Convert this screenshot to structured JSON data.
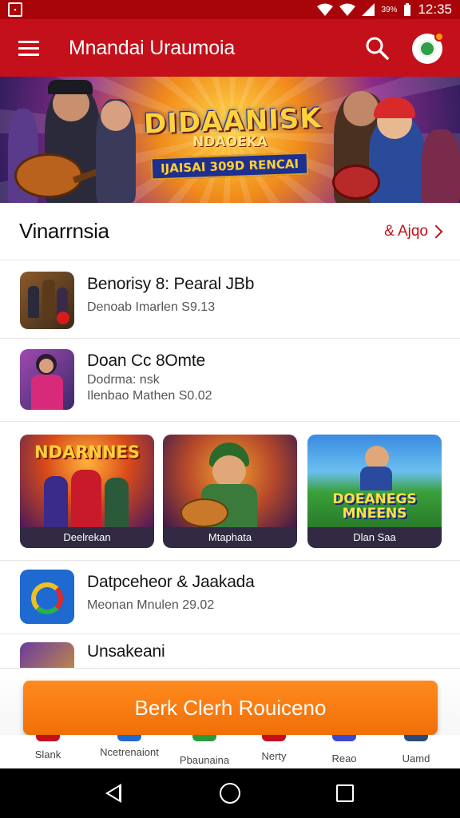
{
  "status_bar": {
    "battery_pct": "39%",
    "time": "12:35"
  },
  "app_bar": {
    "title": "Mnandai Uraumoia"
  },
  "banner": {
    "logo_main": "DIDAANISK",
    "logo_sub": "NDAOEKA",
    "logo_ribbon": "IJAISAI 309D RENCAI"
  },
  "section": {
    "title": "Vinarrnsia",
    "more_label": "& Ajqo"
  },
  "list_items": [
    {
      "title": "Benorisy 8: Pearal JBb",
      "subtitle_1": "Denoab Imarlen S9.13",
      "subtitle_2": ""
    },
    {
      "title": "Doan Cc 8Omte",
      "subtitle_1": "Dodrma: nsk",
      "subtitle_2": "Ilenbao Mathen S0.02"
    },
    {
      "title": "Datpceheor & Jaakada",
      "subtitle_1": "Meonan Mnulen 29.02",
      "subtitle_2": ""
    },
    {
      "title": "Unsakeani",
      "subtitle_1": "",
      "subtitle_2": ""
    }
  ],
  "cards": [
    {
      "heading": "NDARNNES",
      "caption": "Deelrekan"
    },
    {
      "heading": "",
      "caption": "Mtaphata"
    },
    {
      "heading": "DOEANEGS MNEENS",
      "caption": "Dlan Saa"
    }
  ],
  "cta": {
    "label": "Berk Clerh Rouiceno"
  },
  "bottom_nav": [
    {
      "label": "Slank"
    },
    {
      "label": "Ncetrenaiont"
    },
    {
      "label": "Pbaunaina"
    },
    {
      "label": "Nerty"
    },
    {
      "label": "Reao"
    },
    {
      "label": "Uamd"
    }
  ],
  "colors": {
    "primary": "#c4101a",
    "status_bar": "#a8050a",
    "accent": "#f57c0c"
  }
}
